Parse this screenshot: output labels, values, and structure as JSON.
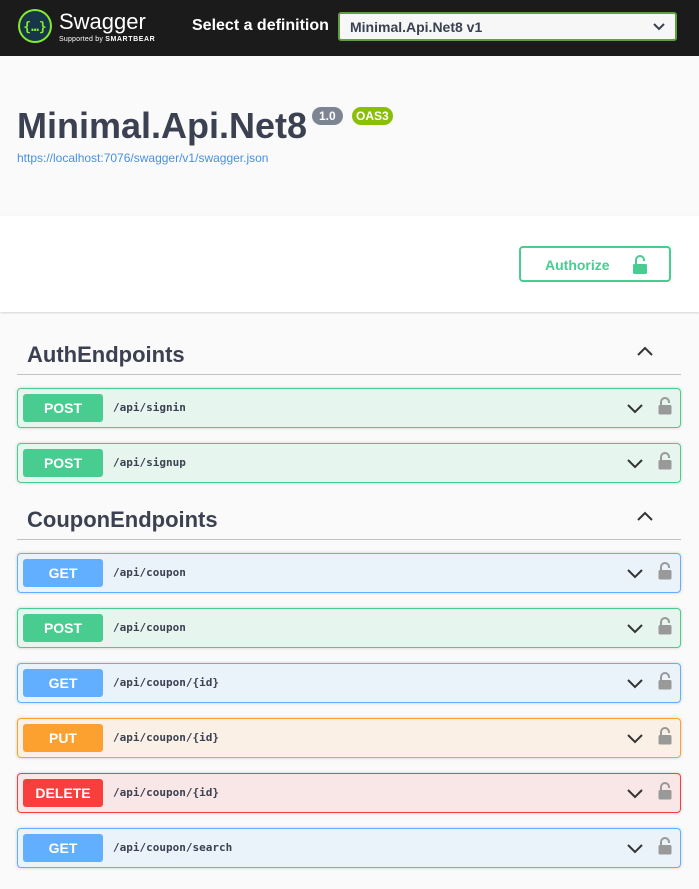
{
  "topbar": {
    "brand_name": "Swagger",
    "brand_sub_prefix": "Supported by ",
    "brand_sub_name": "SMARTBEAR",
    "select_label": "Select a definition",
    "select_value": "Minimal.Api.Net8 v1",
    "accent_color": "#62a03f"
  },
  "info": {
    "title": "Minimal.Api.Net8",
    "version_badge": "1.0",
    "oas_badge": "OAS3",
    "spec_url": "https://localhost:7076/swagger/v1/swagger.json"
  },
  "auth": {
    "authorize_label": "Authorize",
    "icon": "lock-open-icon"
  },
  "sections": [
    {
      "name": "AuthEndpoints",
      "expanded": true,
      "operations": [
        {
          "method": "POST",
          "path": "/api/signin"
        },
        {
          "method": "POST",
          "path": "/api/signup"
        }
      ]
    },
    {
      "name": "CouponEndpoints",
      "expanded": true,
      "operations": [
        {
          "method": "GET",
          "path": "/api/coupon"
        },
        {
          "method": "POST",
          "path": "/api/coupon"
        },
        {
          "method": "GET",
          "path": "/api/coupon/{id}"
        },
        {
          "method": "PUT",
          "path": "/api/coupon/{id}"
        },
        {
          "method": "DELETE",
          "path": "/api/coupon/{id}"
        },
        {
          "method": "GET",
          "path": "/api/coupon/search"
        }
      ]
    }
  ],
  "colors": {
    "post": "#49cc90",
    "get": "#61affe",
    "put": "#fca130",
    "delete": "#f93e3e"
  }
}
